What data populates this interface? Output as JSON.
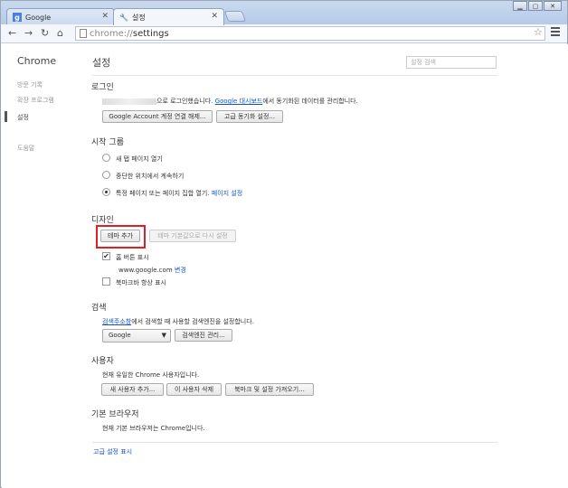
{
  "window": {
    "tabs": [
      {
        "title": "Google",
        "favicon": "google-favicon"
      },
      {
        "title": "설정",
        "favicon": "wrench-icon"
      }
    ]
  },
  "toolbar": {
    "url_scheme": "chrome://",
    "url_path": "settings"
  },
  "sidebar": {
    "title": "Chrome",
    "items": [
      "방문 기록",
      "확장 프로그램",
      "설정",
      "도움말"
    ],
    "selected": "설정"
  },
  "main": {
    "title": "설정",
    "search_placeholder": "설정 검색",
    "login": {
      "heading": "로그인",
      "text_before": "으로 로그인했습니다.",
      "link": "Google 대시보드",
      "text_after": "에서 동기화된 데이터를 관리합니다.",
      "buttons": [
        "Google Account 계정 연결 해제...",
        "고급 동기화 설정..."
      ]
    },
    "startup": {
      "heading": "시작 그룹",
      "options": [
        "새 탭 페이지 열기",
        "중단한 위치에서 계속하기",
        "특정 페이지 또는 페이지 집합 열기."
      ],
      "set_pages_link": "페이지 설정",
      "selected_index": 2
    },
    "design": {
      "heading": "디자인",
      "add_theme": "테마 추가",
      "reset_theme": "테마 기본값으로 다시 설정",
      "home_button_label": "홈 버튼 표시",
      "home_url": "www.google.com",
      "change_link": "변경",
      "bookmarks_bar_label": "북마크바 항상 표시",
      "home_checked": true,
      "bookmarks_checked": false
    },
    "search": {
      "heading": "검색",
      "link": "검색주소창",
      "text": "에서 검색할 때 사용할 검색엔진을 설정합니다.",
      "engine": "Google",
      "manage_button": "검색엔진 관리..."
    },
    "users": {
      "heading": "사용자",
      "text": "현재 유일한 Chrome 사용자입니다.",
      "buttons": [
        "새 사용자 추가...",
        "이 사용자 삭제",
        "북마크 및 설정 가져오기..."
      ]
    },
    "default_browser": {
      "heading": "기본 브라우저",
      "text": "현재 기본 브라우저는 Chrome입니다."
    },
    "advanced_link": "고급 설정 표시"
  }
}
